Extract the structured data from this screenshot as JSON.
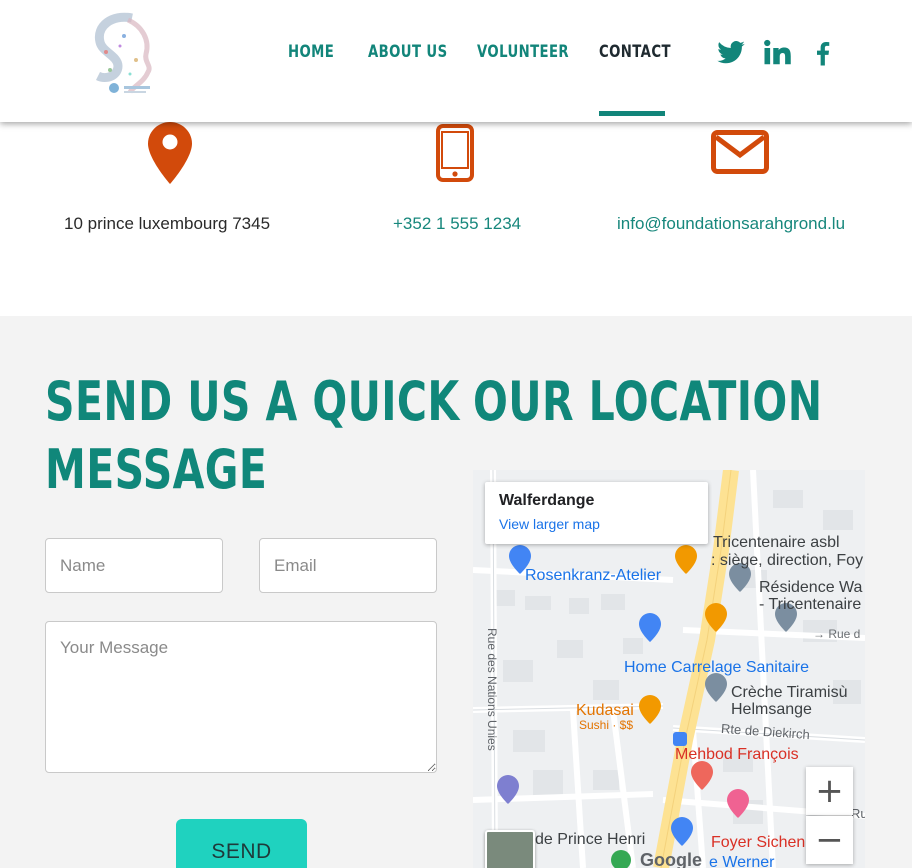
{
  "nav": {
    "items": [
      "HOME",
      "ABOUT US",
      "VOLUNTEER",
      "CONTACT"
    ],
    "active": "CONTACT"
  },
  "social": [
    "twitter-icon",
    "linkedin-icon",
    "facebook-icon"
  ],
  "contact": {
    "address": "10 prince luxembourg 7345",
    "phone": "+352 1 555 1234",
    "email": "info@foundationsarahgrond.lu"
  },
  "form": {
    "title_line1": "SEND US A QUICK",
    "title_line2": "MESSAGE",
    "name_placeholder": "Name",
    "email_placeholder": "Email",
    "message_placeholder": "Your Message",
    "send_label": "SEND"
  },
  "location": {
    "title": "OUR LOCATION",
    "map": {
      "place": "Walferdange",
      "view_larger": "View larger map",
      "labels": {
        "tricentenaire": "Tricentenaire asbl",
        "tricentenaire2": ": siège, direction, Foy",
        "rosenkranz": "Rosenkranz-Atelier",
        "residence": "Résidence Wa",
        "residence2": "- Tricentenaire",
        "rue_right": "→ Rue d",
        "home_carrelage": "Home Carrelage Sanitaire",
        "creche": "Crèche Tiramisù",
        "creche2": "Helmsange",
        "kudasai": "Kudasai",
        "kudasai_sub": "Sushi · $$",
        "rte_diekirch": "Rte de Diekirch",
        "mehbod": "Mehbod François",
        "rue_nations": "Rue des Nations Unies",
        "prince_henri": "de Prince Henri",
        "foyer": "Foyer Sichen",
        "werner": "e Werner",
        "google": "Google",
        "ru": "Ru"
      },
      "zoom_in": "+",
      "zoom_out": "−"
    }
  },
  "colors": {
    "teal": "#12857a",
    "orange": "#d24a0b",
    "button": "#1fd2bf"
  }
}
